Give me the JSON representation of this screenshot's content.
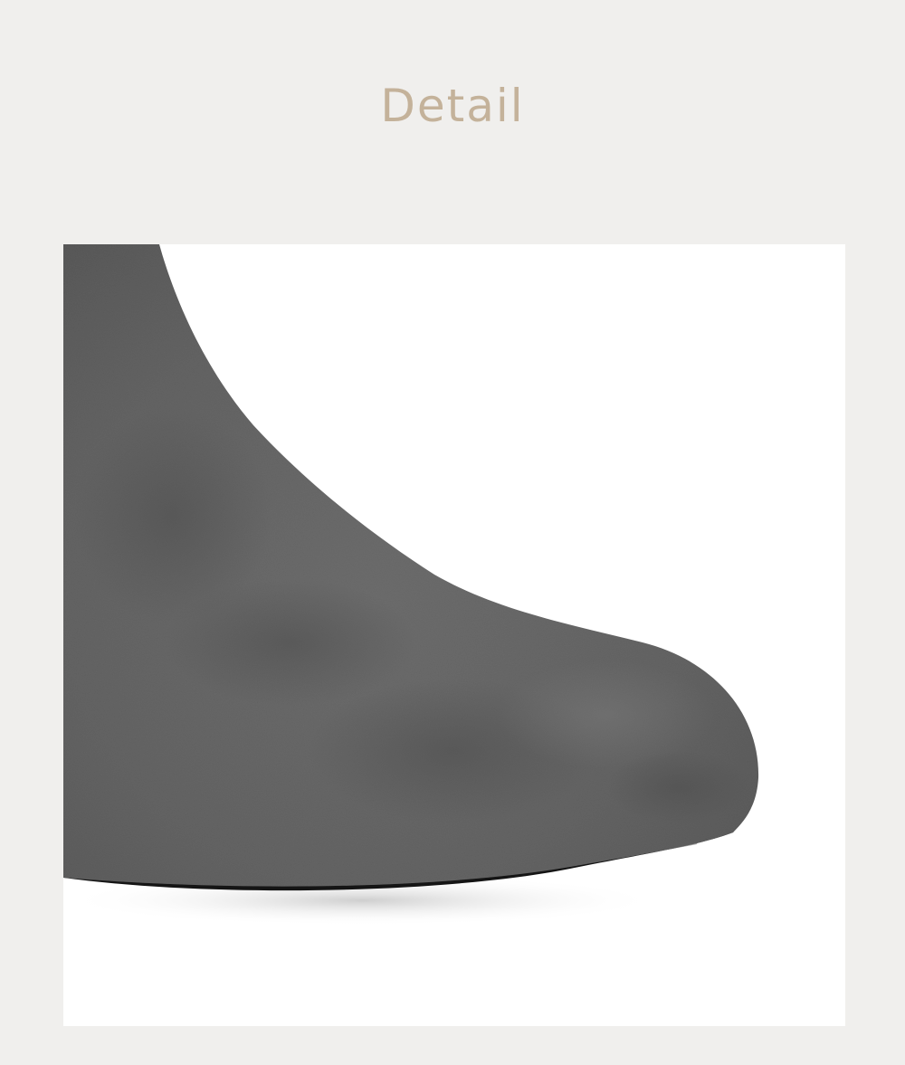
{
  "header": {
    "title": "Detail"
  },
  "photo": {
    "subject": "boot-toe-closeup-image"
  },
  "colors": {
    "page_background": "#f0efed",
    "title": "#c4b29a",
    "photo_background": "#ffffff",
    "suede": "#676767",
    "sole": "#151515"
  }
}
